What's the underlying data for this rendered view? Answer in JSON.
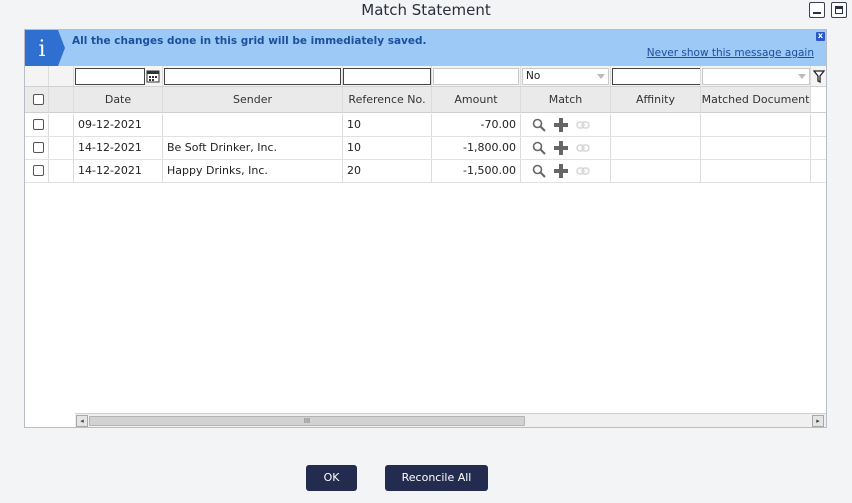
{
  "dialog": {
    "title": "Match Statement"
  },
  "info_bar": {
    "message": "All the changes done in this grid will be immediately saved.",
    "link": "Never show this message again",
    "close_glyph": "x"
  },
  "filters": {
    "match_value": "No"
  },
  "columns": {
    "date": "Date",
    "sender": "Sender",
    "reference": "Reference No.",
    "amount": "Amount",
    "match": "Match",
    "affinity": "Affinity",
    "matched_document": "Matched Document"
  },
  "rows": [
    {
      "date": "09-12-2021",
      "sender": "",
      "reference": "10",
      "amount": "-70.00"
    },
    {
      "date": "14-12-2021",
      "sender": "Be Soft Drinker, Inc.",
      "reference": "10",
      "amount": "-1,800.00"
    },
    {
      "date": "14-12-2021",
      "sender": "Happy Drinks, Inc.",
      "reference": "20",
      "amount": "-1,500.00"
    }
  ],
  "scrollbar": {
    "left_glyph": "◂",
    "right_glyph": "▸",
    "thumb_glyph": "III"
  },
  "buttons": {
    "ok": "OK",
    "reconcile_all": "Reconcile All"
  },
  "colors": {
    "info_bg": "#9dc9f7",
    "info_text": "#1c4f9c",
    "button_bg": "#232c4e"
  },
  "icons": {
    "info": "info-icon",
    "calendar": "calendar-icon",
    "filter": "filter-icon",
    "search": "search-icon",
    "add": "plus-icon",
    "link": "link-icon"
  }
}
